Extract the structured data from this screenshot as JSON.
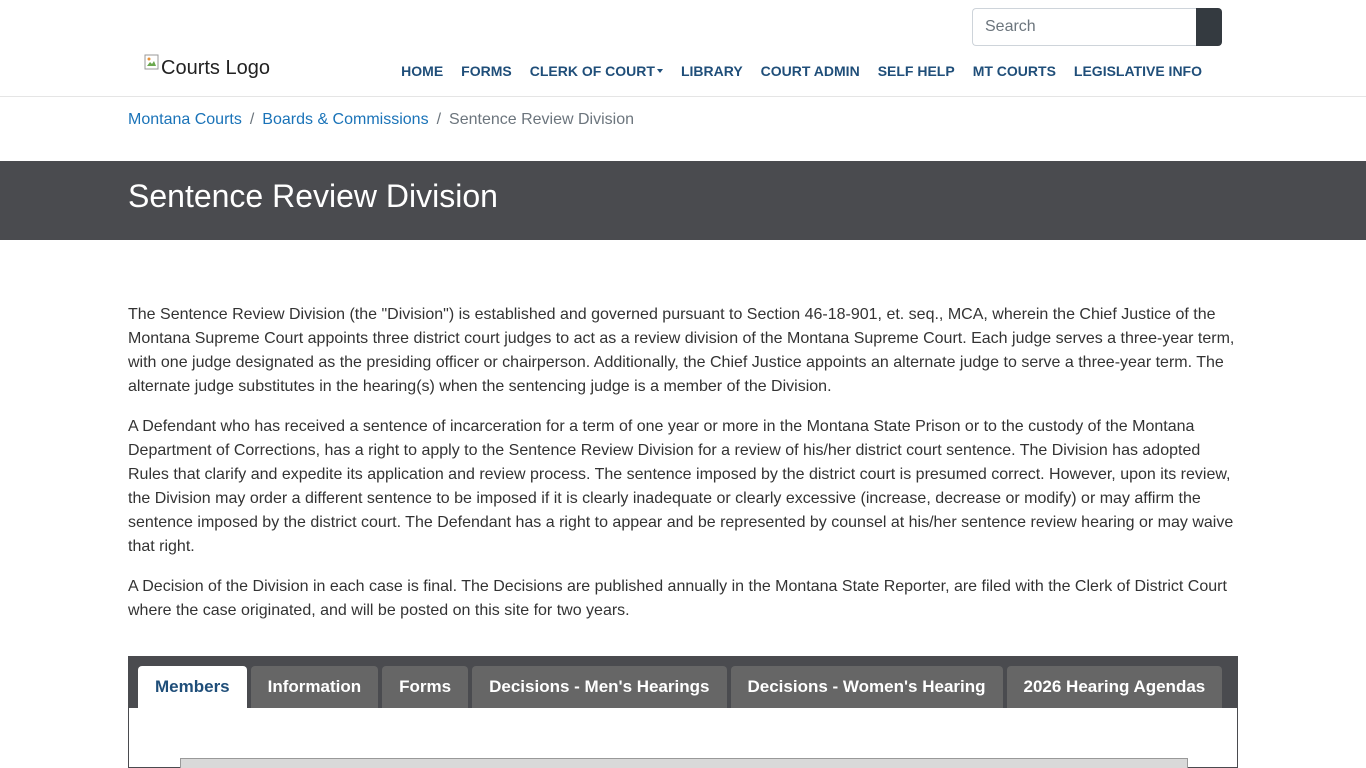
{
  "header": {
    "search_placeholder": "Search",
    "logo_alt": "Courts Logo",
    "nav": [
      {
        "label": "HOME"
      },
      {
        "label": "FORMS"
      },
      {
        "label": "CLERK OF COURT"
      },
      {
        "label": "LIBRARY"
      },
      {
        "label": "COURT ADMIN"
      },
      {
        "label": "SELF HELP"
      },
      {
        "label": "MT COURTS"
      },
      {
        "label": "LEGISLATIVE INFO"
      }
    ]
  },
  "breadcrumb": {
    "items": [
      "Montana Courts",
      "Boards & Commissions"
    ],
    "separator": "/",
    "current": "Sentence Review Division"
  },
  "page": {
    "title": "Sentence Review Division",
    "paragraphs": [
      "The Sentence Review Division (the \"Division\") is established and governed pursuant to Section 46-18-901, et. seq., MCA, wherein the Chief Justice of the Montana Supreme Court appoints three district court judges to act as a review division of the Montana Supreme Court.  Each judge serves a three-year term, with one judge designated as the presiding officer or chairperson.  Additionally, the Chief Justice appoints an alternate judge to serve a three-year term.  The alternate judge substitutes in the hearing(s) when the sentencing judge is a member of the Division.",
      "A Defendant who has received a sentence of incarceration for a term of one year or more in the Montana State Prison or to the custody of the Montana Department of Corrections, has a right to apply to the Sentence Review Division for a review of his/her district court sentence.  The Division has adopted Rules that clarify and expedite its application and review process.  The sentence imposed by the district court is presumed correct.  However, upon its review, the Division may order a different sentence to be imposed if it is clearly inadequate or clearly excessive (increase, decrease or modify) or may affirm the sentence imposed by the district court.  The Defendant has a right to appear and be represented by counsel at his/her sentence review hearing or may waive that right.",
      "A Decision of the Division in each case is final.  The Decisions are published annually in the Montana State Reporter, are filed with the Clerk of District Court where the case originated, and will be posted on this site for two years."
    ]
  },
  "tabs": [
    {
      "label": "Members"
    },
    {
      "label": "Information"
    },
    {
      "label": "Forms"
    },
    {
      "label": "Decisions - Men's Hearings"
    },
    {
      "label": "Decisions - Women's Hearing"
    },
    {
      "label": "2026 Hearing Agendas"
    }
  ],
  "active_tab": "Members",
  "colors": {
    "nav_text": "#1f4e79",
    "link": "#1a73b8",
    "banner": "#4a4b4f",
    "tab_inactive": "#666666"
  }
}
